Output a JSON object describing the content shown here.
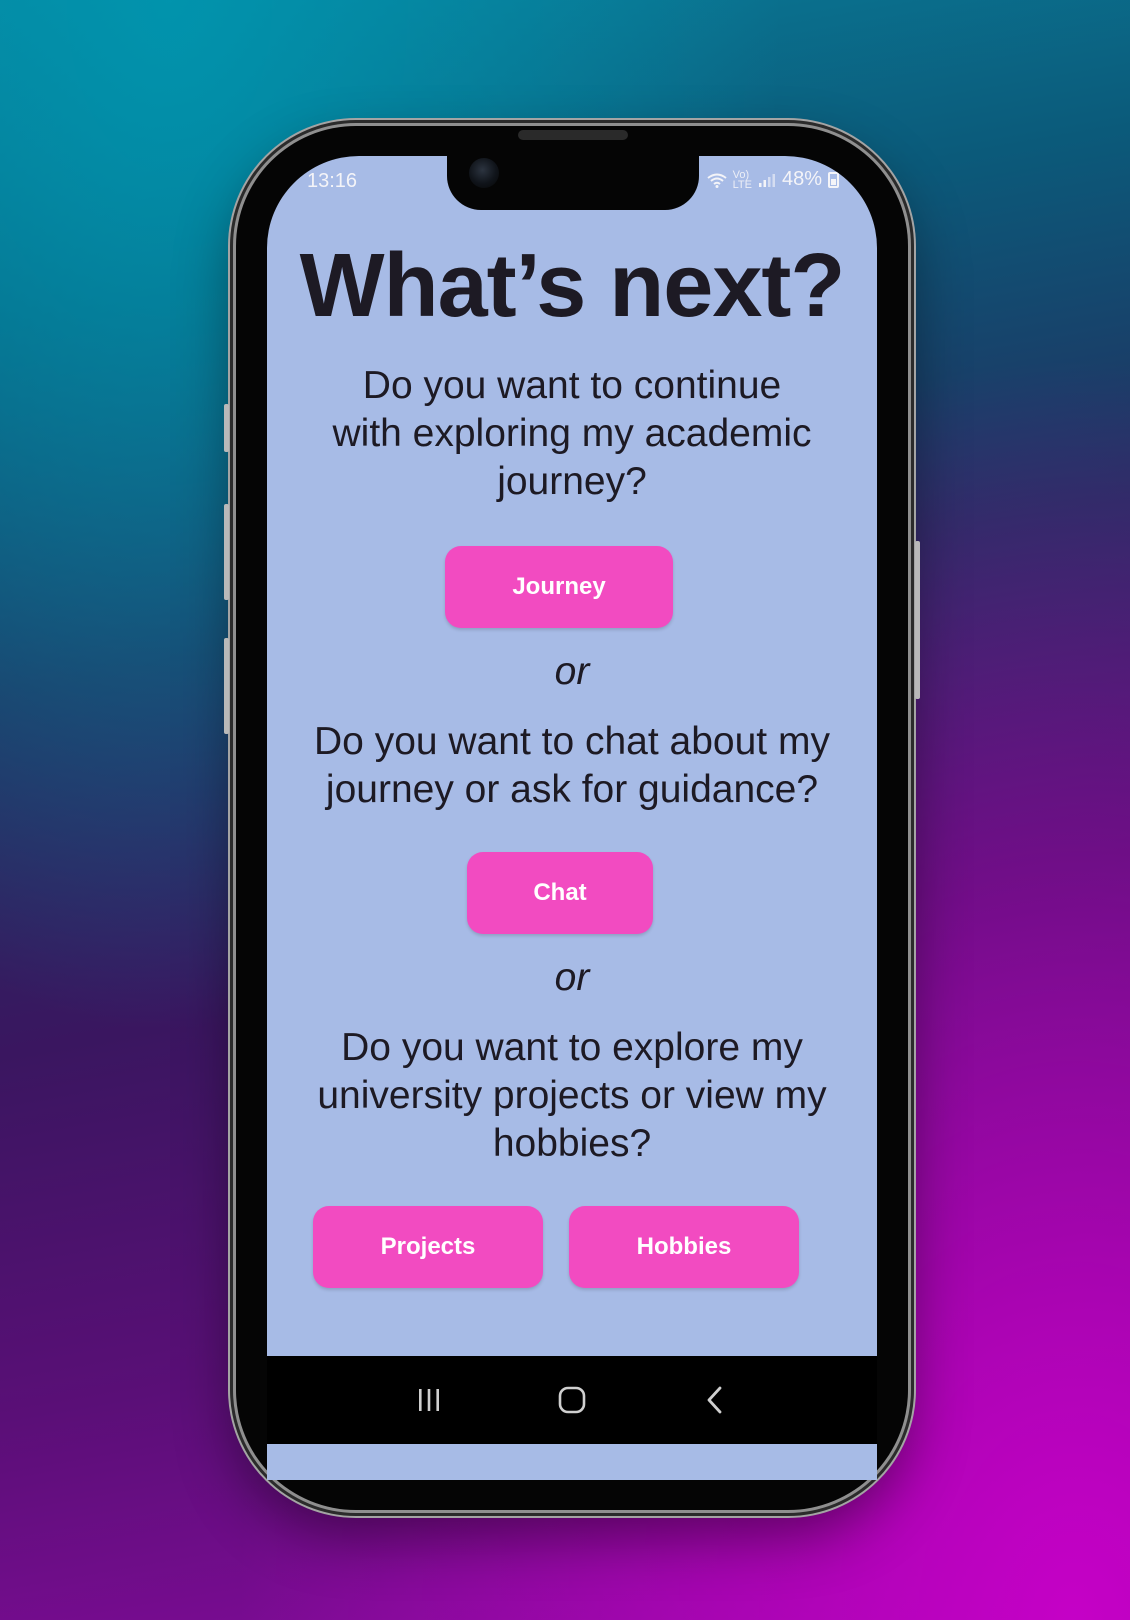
{
  "status_bar": {
    "time": "13:16",
    "network_label_top": "Vo)",
    "network_label_bottom": "LTE",
    "battery": "48%"
  },
  "page": {
    "title": "What’s next?",
    "sections": [
      {
        "question_lines": [
          "Do you want to continue",
          "with exploring my academic",
          "journey?"
        ],
        "button_label": "Journey"
      },
      {
        "question_lines": [
          "Do you want to chat about my",
          "journey or ask for guidance?"
        ],
        "button_label": "Chat"
      },
      {
        "question_lines": [
          "Do you want to explore my",
          "university projects or view my",
          "hobbies?"
        ],
        "button_labels": [
          "Projects",
          "Hobbies"
        ]
      }
    ],
    "separator": "or"
  },
  "navigation": {
    "icons": [
      "recent-apps-icon",
      "home-icon",
      "back-icon"
    ]
  },
  "colors": {
    "screen_background": "#a7bbe6",
    "button_background": "#f24bc1",
    "button_text": "#ffffff",
    "text": "#1d1a24"
  }
}
